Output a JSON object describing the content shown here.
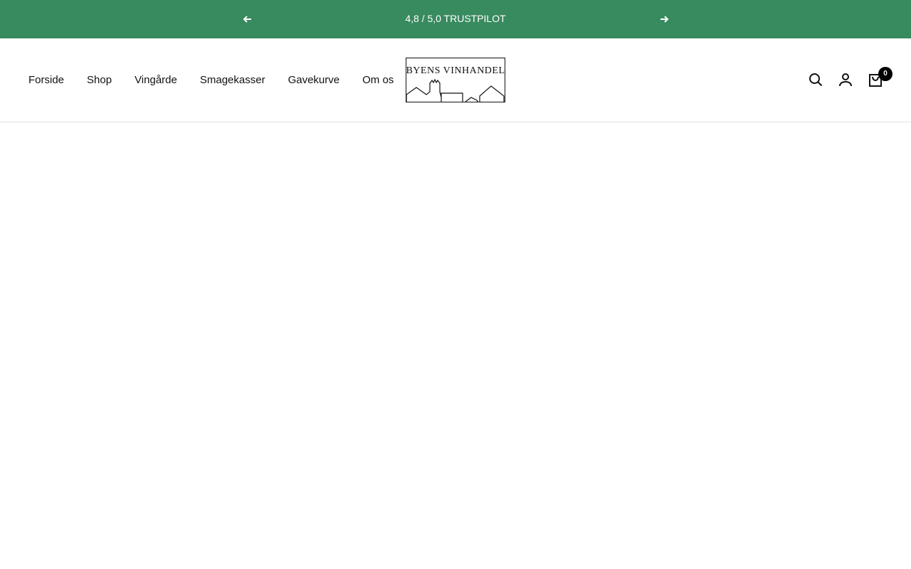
{
  "announcement": {
    "text": "4,8 / 5,0 TRUSTPILOT",
    "color": "#388a5f",
    "prev_icon": "arrow-left-icon",
    "next_icon": "arrow-right-icon"
  },
  "nav": {
    "items": [
      "Forside",
      "Shop",
      "Vingårde",
      "Smagekasser",
      "Gavekurve",
      "Om os"
    ]
  },
  "logo": {
    "text": "Byens Vinhandel"
  },
  "header_icons": {
    "search": "search-icon",
    "account": "account-icon",
    "cart": "cart-icon",
    "cart_count": "0"
  }
}
